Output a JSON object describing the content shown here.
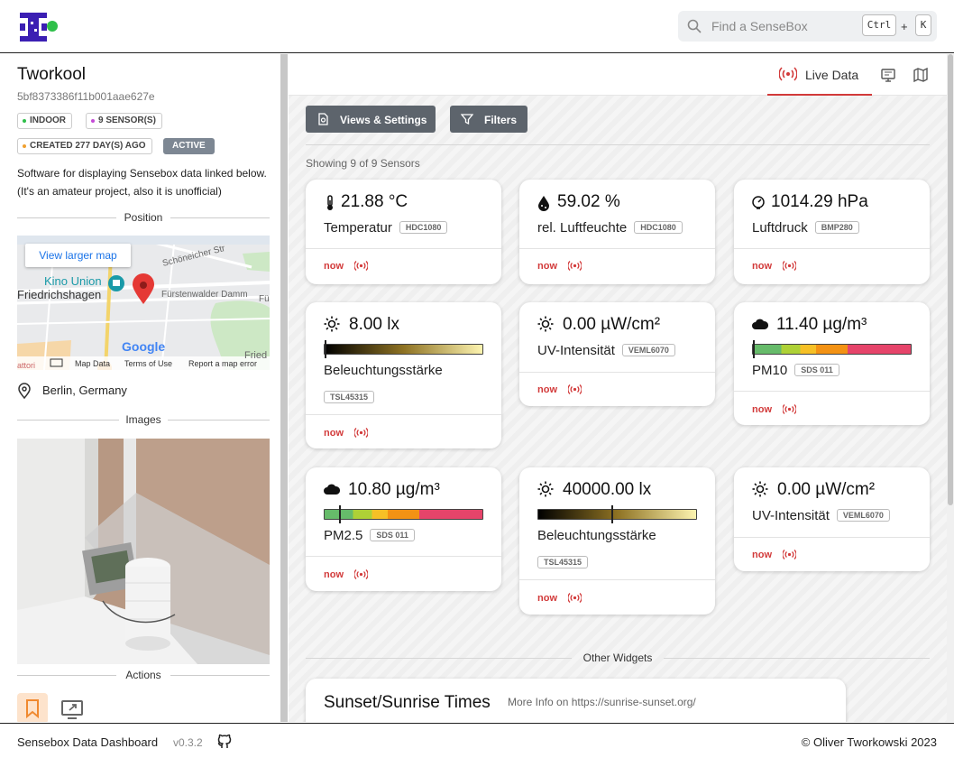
{
  "header": {
    "search_placeholder": "Find a SenseBox",
    "shortcut_key1": "Ctrl",
    "shortcut_plus": "+",
    "shortcut_key2": "K"
  },
  "sidebar": {
    "title": "Tworkool",
    "id": "5bf8373386f11b001aae627e",
    "badges": {
      "exposure": "INDOOR",
      "sensors": "9 SENSOR(S)",
      "created": "CREATED 277 DAY(S) AGO",
      "status": "ACTIVE"
    },
    "description": "Software for displaying Sensebox data linked below. (It's an amateur project, also it is unofficial)",
    "position_heading": "Position",
    "map": {
      "link": "View larger map",
      "street1": "Schöneicher Str",
      "street2": "Fürstenwalder Damm",
      "street2_cut": "Fü",
      "poi": "Kino Union",
      "area": "Friedrichshagen",
      "provider": "Google",
      "footer_data": "Map Data",
      "footer_terms": "Terms of Use",
      "footer_report": "Report a map error",
      "cut_left": "attori",
      "cut_right": "Fried"
    },
    "location": "Berlin, Germany",
    "images_heading": "Images",
    "actions_heading": "Actions"
  },
  "main": {
    "tabs": {
      "live": "Live Data"
    },
    "buttons": {
      "views": "Views & Settings",
      "filters": "Filters"
    },
    "showing": "Showing 9 of 9 Sensors",
    "now_label": "now",
    "cards": [
      {
        "value": "21.88 °C",
        "name": "Temperatur",
        "sensor": "HDC1080",
        "icon": "thermometer-icon"
      },
      {
        "value": "59.02 %",
        "name": "rel. Luftfeuchte",
        "sensor": "HDC1080",
        "icon": "droplet-icon"
      },
      {
        "value": "1014.29 hPa",
        "name": "Luftdruck",
        "sensor": "BMP280",
        "icon": "gauge-icon"
      },
      {
        "value": "8.00 lx",
        "name": "Beleuchtungsstärke",
        "sensor": "TSL45315",
        "icon": "sun-icon",
        "level": 0.0
      },
      {
        "value": "0.00 µW/cm²",
        "name": "UV-Intensität",
        "sensor": "VEML6070",
        "icon": "sun-icon"
      },
      {
        "value": "11.40 µg/m³",
        "name": "PM10",
        "sensor": "SDS 011",
        "icon": "cloud-icon",
        "level": 0.0
      },
      {
        "value": "10.80 µg/m³",
        "name": "PM2.5",
        "sensor": "SDS 011",
        "icon": "cloud-icon",
        "level": 0.09
      },
      {
        "value": "40000.00 lx",
        "name": "Beleuchtungsstärke",
        "sensor": "TSL45315",
        "icon": "sun-icon",
        "level": 0.46
      },
      {
        "value": "0.00 µW/cm²",
        "name": "UV-Intensität",
        "sensor": "VEML6070",
        "icon": "sun-icon"
      }
    ],
    "other_widgets": "Other Widgets",
    "sunset": {
      "title": "Sunset/Sunrise Times",
      "more": "More Info on https://sunrise-sunset.org/"
    }
  },
  "footer": {
    "brand": "Sensebox Data Dashboard",
    "version": "v0.3.2",
    "copyright": "© Oliver Tworkowski 2023"
  },
  "colors": {
    "accent_red": "#d23a3a",
    "button_grey": "#5d646c",
    "logo_purple": "#3b1fb3",
    "online_green": "#2fbf4a"
  }
}
